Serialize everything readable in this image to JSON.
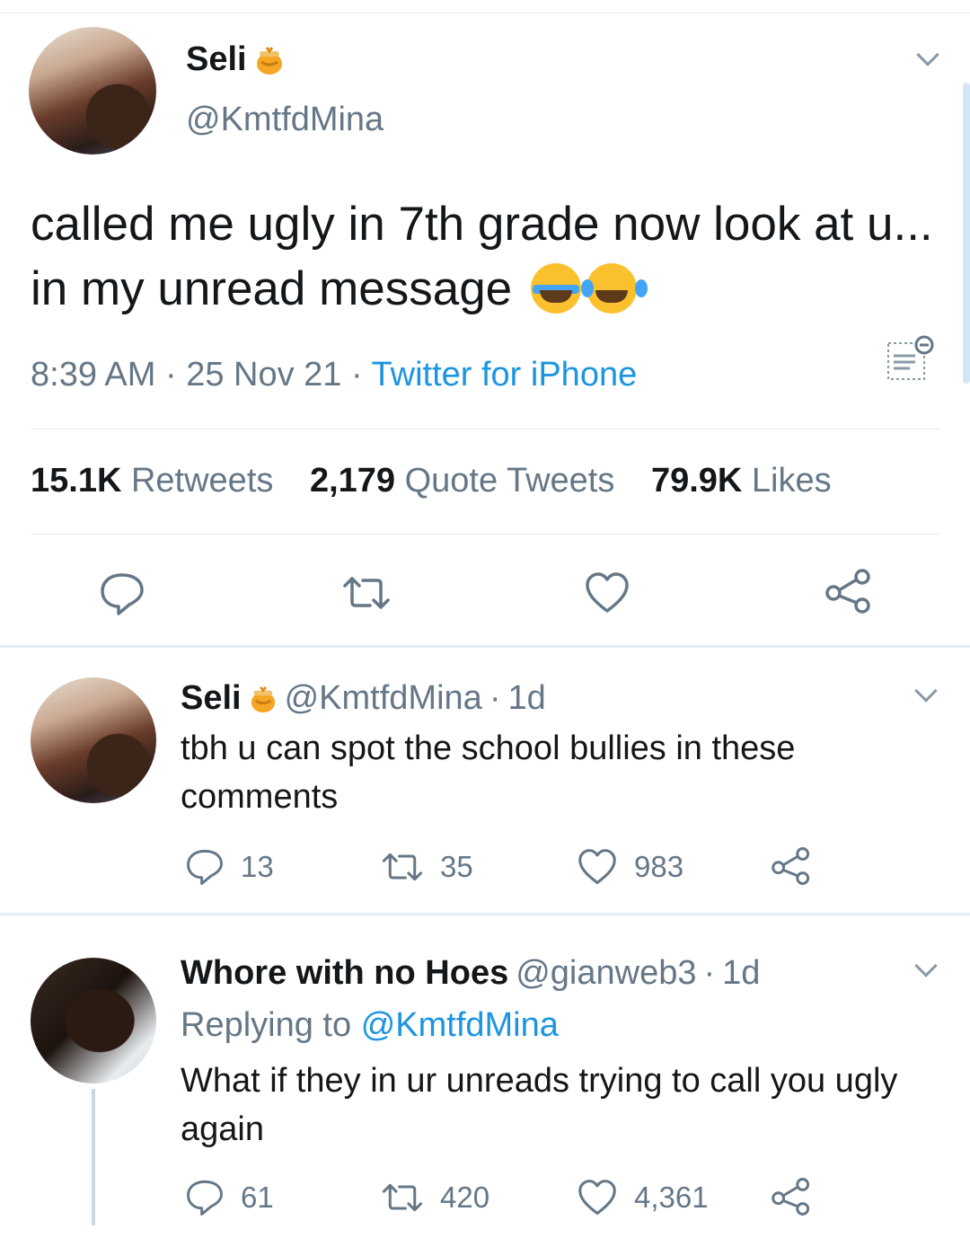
{
  "main_tweet": {
    "name": "Seli",
    "handle": "@KmtfdMina",
    "text": "called me ugly in 7th grade now look at u... in my unread message",
    "emojis": [
      "loudly-crying-face",
      "face-with-tears-of-joy"
    ],
    "time": "8:39 AM",
    "date": "25 Nov 21",
    "source": "Twitter for iPhone",
    "retweets_count": "15.1K",
    "retweets_label": "Retweets",
    "quotes_count": "2,179",
    "quotes_label": "Quote Tweets",
    "likes_count": "79.9K",
    "likes_label": "Likes"
  },
  "replies": [
    {
      "name": "Seli",
      "handle": "@KmtfdMina",
      "age": "1d",
      "text": "tbh u can spot the school bullies in these comments",
      "replies": "13",
      "retweets": "35",
      "likes": "983"
    },
    {
      "name": "Whore with no Hoes",
      "handle": "@gianweb3",
      "age": "1d",
      "replying_prefix": "Replying to",
      "replying_to": "@KmtfdMina",
      "text": "What if they in ur unreads trying to call you ugly again",
      "replies": "61",
      "retweets": "420",
      "likes": "4,361"
    }
  ],
  "separators": {
    "dot": "·"
  },
  "colors": {
    "link": "#1b95e0",
    "muted": "#657786",
    "text": "#14171a",
    "divider": "#e6ecf0"
  }
}
